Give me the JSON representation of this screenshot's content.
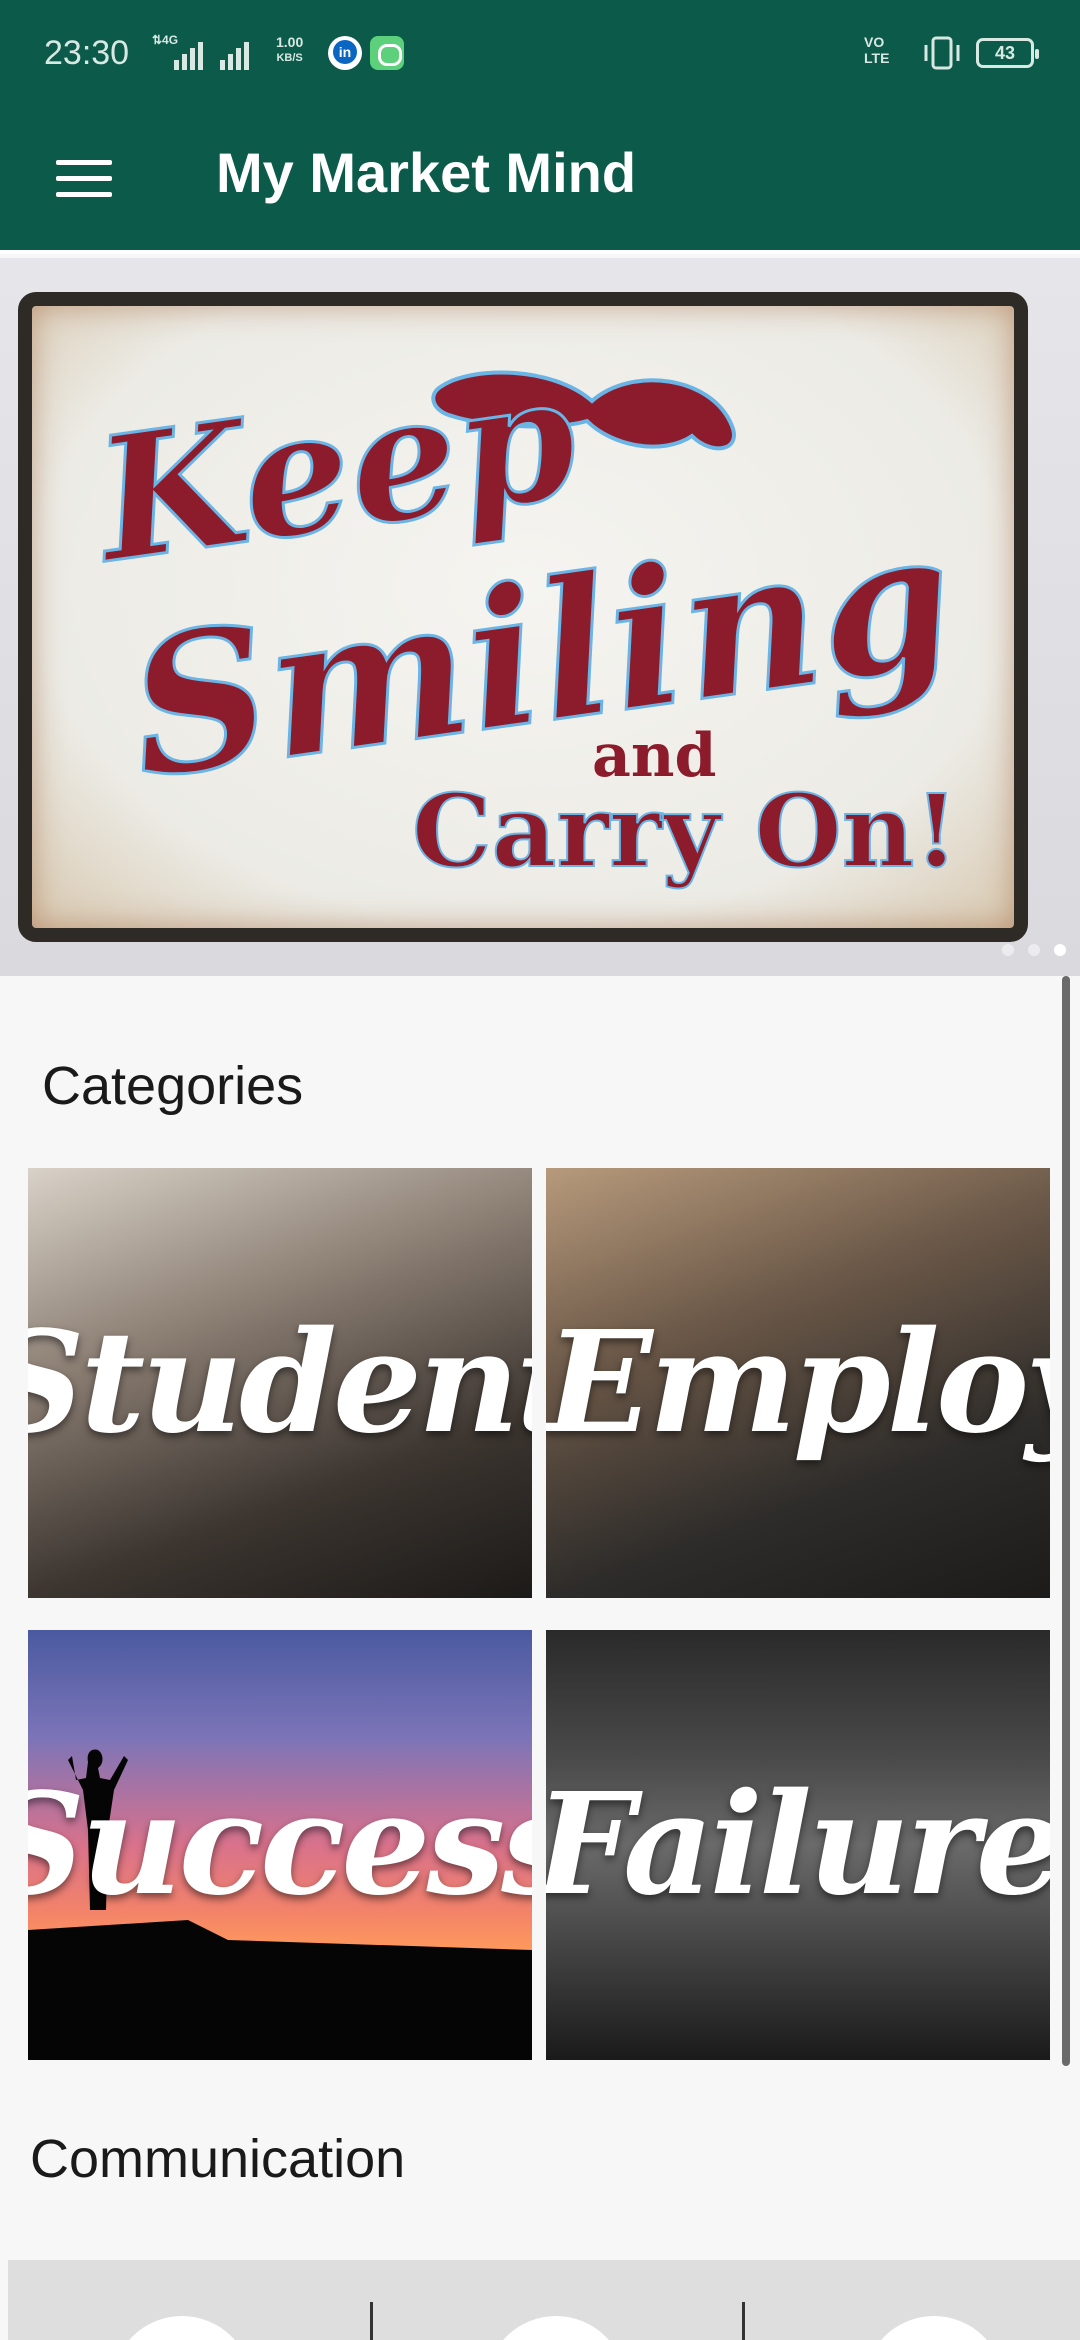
{
  "status_bar": {
    "time": "23:30",
    "network": "4G",
    "speed_value": "1.00",
    "speed_unit": "KB/S",
    "volte": "VO LTE",
    "battery": "43"
  },
  "app_bar": {
    "title": "My Market Mind",
    "menu_icon": "hamburger-menu-icon"
  },
  "banner": {
    "line1": "Keep",
    "line2": "Smiling",
    "line3": "and",
    "line4": "Carry On!",
    "dots": 3,
    "active_dot": 2
  },
  "categories": {
    "title": "Categories",
    "items": [
      {
        "label": "Student"
      },
      {
        "label": "Employee"
      },
      {
        "label": "Success"
      },
      {
        "label": "Failure"
      }
    ]
  },
  "communication": {
    "title": "Communication"
  },
  "colors": {
    "primary": "#0b5a4a",
    "background": "#f7f7f7",
    "sign_red": "#8c1c2c",
    "sign_blue": "#6ab4e6"
  }
}
